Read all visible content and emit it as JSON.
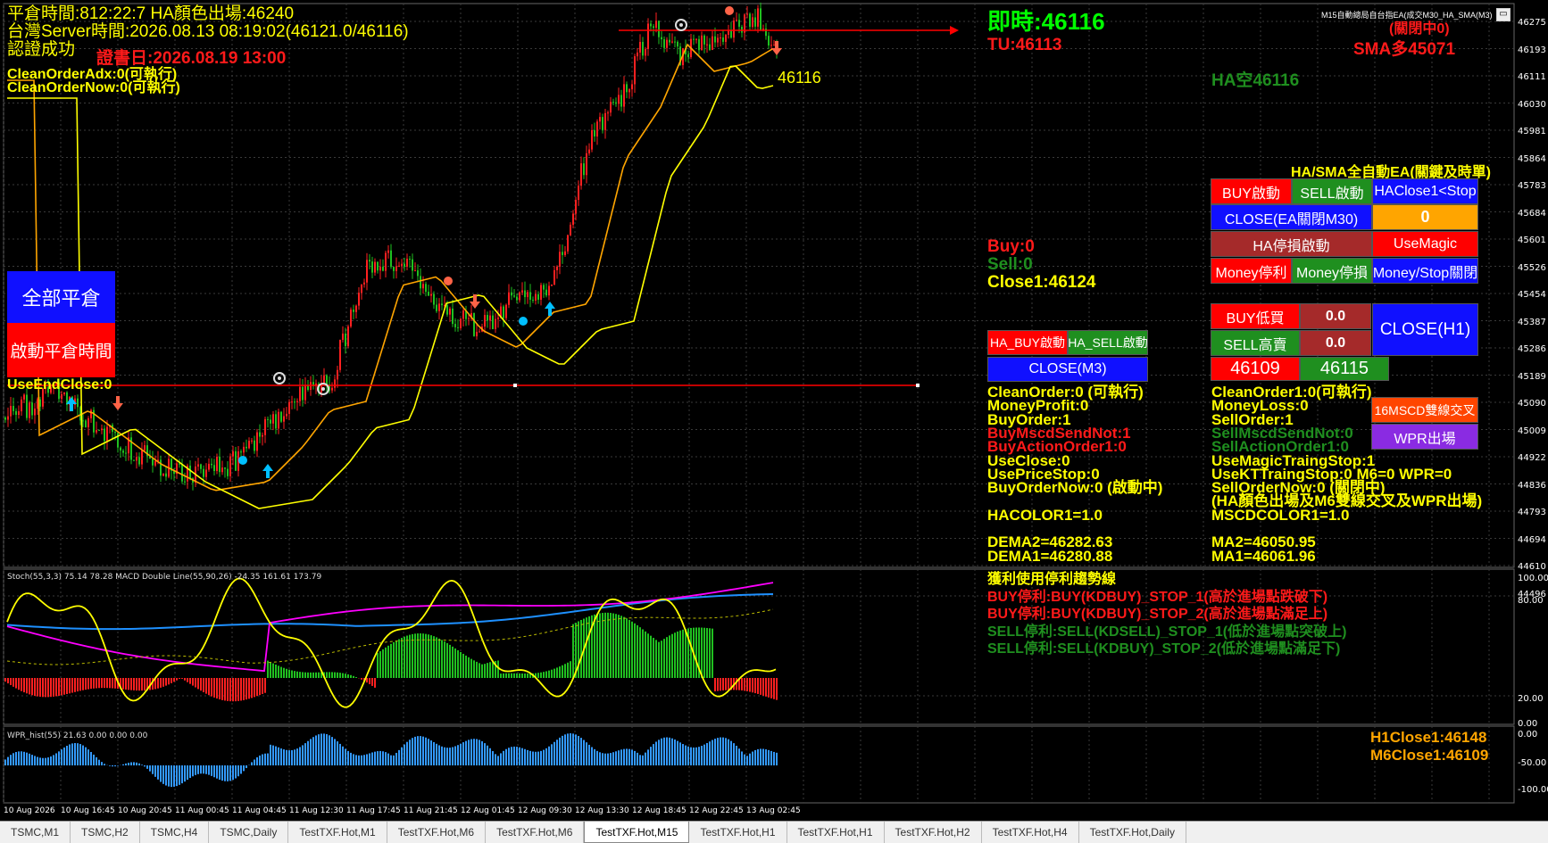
{
  "overlay_left": {
    "line1": "平倉時間:812:22:7 HA顏色出場:46240",
    "line2": "台灣Server時間:2026.08.13 08:19:02(46121.0/46116)",
    "line3": "認證成功",
    "line3b": "證書日:2026.08.19 13:00",
    "line4": "CleanOrderAdx:0(可執行)",
    "line5": "CleanOrderNow:0(可執行)"
  },
  "left_buttons": {
    "close_all": "全部平倉",
    "start_time": "啟動平倉時間",
    "use_end_close": "UseEndClose:0"
  },
  "price_label": "46116",
  "window_title": "M15自動總局自台指EA(成交M30_HA_SMA(M3)",
  "top_right": {
    "realtime": "即時:46116",
    "tu": "TU:46113",
    "status": "(關閉中0)",
    "sma": "SMA多45071",
    "ha": "HA空46116"
  },
  "ea_title": "HA/SMA全自動EA(關鍵及時單)",
  "panel_buttons": {
    "buy_start": "BUY啟動",
    "sell_start": "SELL啟動",
    "haclose": "HAClose1<Stop",
    "close_ea": "CLOSE(EA關閉M30)",
    "zero": "0",
    "ha_stop": "HA停損啟動",
    "use_magic": "UseMagic",
    "money_profit": "Money停利",
    "money_loss": "Money停損",
    "money_stop": "Money/Stop關閉",
    "buy_low": "BUY低買",
    "buy_low_val": "0.0",
    "sell_high": "SELL高賣",
    "sell_high_val": "0.0",
    "close_h1": "CLOSE(H1)",
    "p1": "46109",
    "p2": "46115",
    "ha_buy": "HA_BUY啟動",
    "ha_sell": "HA_SELL啟動",
    "close_m3": "CLOSE(M3)",
    "msc": "16MSCD雙線交叉",
    "wpr": "WPR出場"
  },
  "mid_info": {
    "buy": "Buy:0",
    "sell": "Sell:0",
    "close1": "Close1:46124"
  },
  "info_left": [
    {
      "t": "CleanOrder:0 (可執行)",
      "c": "#ffff00"
    },
    {
      "t": "MoneyProfit:0",
      "c": "#ffff00"
    },
    {
      "t": "BuyOrder:1",
      "c": "#ffff00"
    },
    {
      "t": "BuyMscdSendNot:1",
      "c": "#ff1a1a"
    },
    {
      "t": "BuyActionOrder1:0",
      "c": "#ff1a1a"
    },
    {
      "t": "UseClose:0",
      "c": "#ffff00"
    },
    {
      "t": "UsePriceStop:0",
      "c": "#ffff00"
    },
    {
      "t": "BuyOrderNow:0 (啟動中)",
      "c": "#ffff00"
    },
    {
      "t": "",
      "c": "#ffff00"
    },
    {
      "t": "HACOLOR1=1.0",
      "c": "#ffff00"
    },
    {
      "t": "",
      "c": "#ffff00"
    },
    {
      "t": "DEMA2=46282.63",
      "c": "#ffff00"
    },
    {
      "t": "DEMA1=46280.88",
      "c": "#ffff00"
    }
  ],
  "info_right": [
    {
      "t": "CleanOrder1:0(可執行)",
      "c": "#ffff00"
    },
    {
      "t": "MoneyLoss:0",
      "c": "#ffff00"
    },
    {
      "t": "SellOrder:1",
      "c": "#ffff00"
    },
    {
      "t": "SellMscdSendNot:0",
      "c": "#1f8f1f"
    },
    {
      "t": "SellActionOrder1:0",
      "c": "#1f8f1f"
    },
    {
      "t": "UseMagicTraingStop:1",
      "c": "#ffff00"
    },
    {
      "t": "UseKTTraingStop:0  M6=0  WPR=0",
      "c": "#ffff00"
    },
    {
      "t": "SellOrderNow:0 (關閉中)",
      "c": "#ffff00"
    },
    {
      "t": "(HA顏色出場及M6雙線交叉及WPR出場)",
      "c": "#ffff00"
    },
    {
      "t": "MSCDCOLOR1=1.0",
      "c": "#ffff00"
    },
    {
      "t": "",
      "c": "#ffff00"
    },
    {
      "t": "MA2=46050.95",
      "c": "#ffff00"
    },
    {
      "t": "MA1=46061.96",
      "c": "#ffff00"
    }
  ],
  "stop_lines": [
    {
      "t": "獲利使用停利趨勢線",
      "c": "#ffff00"
    },
    {
      "t": "BUY停利:BUY(KDBUY)_STOP_1(高於進場點跌破下)",
      "c": "#ff1a1a"
    },
    {
      "t": "BUY停利:BUY(KDBUY)_STOP_2(高於進場點滿足上)",
      "c": "#ff1a1a"
    },
    {
      "t": "SELL停利:SELL(KDSELL)_STOP_1(低於進場點突破上)",
      "c": "#1f8f1f"
    },
    {
      "t": "SELL停利:SELL(KDBUY)_STOP_2(低於進場點滿足下)",
      "c": "#1f8f1f"
    }
  ],
  "bottom_right": {
    "h1close": "H1Close1:46148",
    "m6close": "M6Close1:46109"
  },
  "indicator_titles": {
    "stoch": "Stoch(55,3,3) 75.14 78.28 MACD Double Line(55,90,26) -24.35 161.61 173.79",
    "wpr": "WPR_hist(55) 21.63 0.00 0.00 0.00"
  },
  "y_axis_main": [
    "46275",
    "46193",
    "46111",
    "46030",
    "45981",
    "45864",
    "45783",
    "45684",
    "45601",
    "45526",
    "45454",
    "45387",
    "45286",
    "45189",
    "45090",
    "45009",
    "44922",
    "44836",
    "44793",
    "44694",
    "44610",
    "44496"
  ],
  "y_axis_stoch": [
    "100.00",
    "80.00",
    "20.00",
    "0.00"
  ],
  "y_axis_wpr": [
    "0.00",
    "-50.00",
    "-100.00"
  ],
  "x_axis": [
    "10 Aug 2026",
    "10 Aug 16:45",
    "10 Aug 20:45",
    "11 Aug 00:45",
    "11 Aug 04:45",
    "11 Aug 12:30",
    "11 Aug 17:45",
    "11 Aug 21:45",
    "12 Aug 01:45",
    "12 Aug 09:30",
    "12 Aug 13:30",
    "12 Aug 18:45",
    "12 Aug 22:45",
    "13 Aug 02:45"
  ],
  "tabs": [
    {
      "label": "TSMC,M1",
      "active": false
    },
    {
      "label": "TSMC,H2",
      "active": false
    },
    {
      "label": "TSMC,H4",
      "active": false
    },
    {
      "label": "TSMC,Daily",
      "active": false
    },
    {
      "label": "TestTXF.Hot,M1",
      "active": false
    },
    {
      "label": "TestTXF.Hot,M6",
      "active": false
    },
    {
      "label": "TestTXF.Hot,M6",
      "active": false
    },
    {
      "label": "TestTXF.Hot,M15",
      "active": true
    },
    {
      "label": "TestTXF.Hot,H1",
      "active": false
    },
    {
      "label": "TestTXF.Hot,H1",
      "active": false
    },
    {
      "label": "TestTXF.Hot,H2",
      "active": false
    },
    {
      "label": "TestTXF.Hot,H4",
      "active": false
    },
    {
      "label": "TestTXF.Hot,Daily",
      "active": false
    }
  ]
}
